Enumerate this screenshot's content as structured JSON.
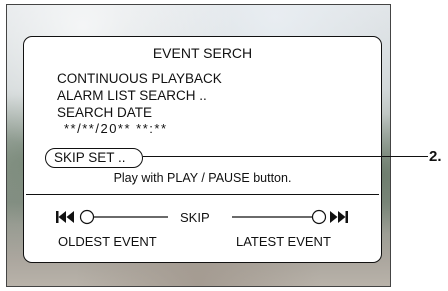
{
  "menu": {
    "title": "EVENT SERCH",
    "items": [
      {
        "label": "CONTINUOUS PLAYBACK"
      },
      {
        "label": "ALARM LIST SEARCH .."
      },
      {
        "label": "SEARCH DATE"
      }
    ],
    "date_value": "**/**/20**  **:**",
    "selected_item": "SKIP SET ..",
    "hint": "Play with PLAY / PAUSE button."
  },
  "skip_bar": {
    "label": "SKIP",
    "left_icon": "skip-previous-icon",
    "right_icon": "skip-next-icon",
    "left_caption": "OLDEST EVENT",
    "right_caption": "LATEST EVENT"
  },
  "callout": {
    "number": "2."
  },
  "colors": {
    "text": "#111111",
    "panel": "#ffffff"
  }
}
